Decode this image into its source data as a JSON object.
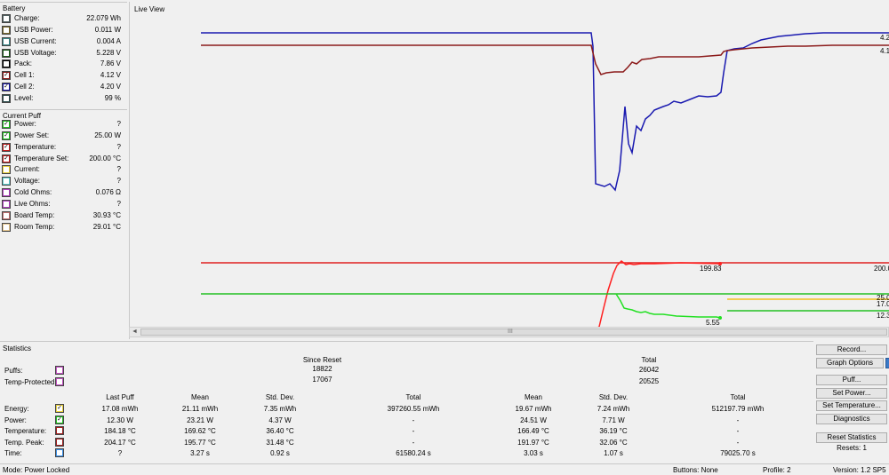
{
  "battery": {
    "title": "Battery",
    "rows": [
      {
        "label": "Charge:",
        "value": "22.079 Wh",
        "color": "#506060",
        "checked": false
      },
      {
        "label": "USB Power:",
        "value": "0.011 W",
        "color": "#7a6a2e",
        "checked": false
      },
      {
        "label": "USB Current:",
        "value": "0.004 A",
        "color": "#3a8a8a",
        "checked": false
      },
      {
        "label": "USB Voltage:",
        "value": "5.228 V",
        "color": "#1a5a1a",
        "checked": false
      },
      {
        "label": "Pack:",
        "value": "7.86 V",
        "color": "#000000",
        "checked": false
      },
      {
        "label": "Cell 1:",
        "value": "4.12 V",
        "color": "#8b1a1a",
        "checked": true
      },
      {
        "label": "Cell 2:",
        "value": "4.20 V",
        "color": "#1a1aa8",
        "checked": true
      },
      {
        "label": "Level:",
        "value": "99 %",
        "color": "#2e4e4e",
        "checked": false
      }
    ]
  },
  "current_puff": {
    "title": "Current Puff",
    "rows": [
      {
        "label": "Power:",
        "value": "?",
        "color": "#22c022",
        "checked": true
      },
      {
        "label": "Power Set:",
        "value": "25.00 W",
        "color": "#22c022",
        "checked": true
      },
      {
        "label": "Temperature:",
        "value": "?",
        "color": "#c02020",
        "checked": true
      },
      {
        "label": "Temperature Set:",
        "value": "200.00 °C",
        "color": "#c02020",
        "checked": true
      },
      {
        "label": "Current:",
        "value": "?",
        "color": "#e8d040",
        "checked": false
      },
      {
        "label": "Voltage:",
        "value": "?",
        "color": "#60d0d0",
        "checked": false
      },
      {
        "label": "Cold Ohms:",
        "value": "0.076 Ω",
        "color": "#b040c0",
        "checked": false
      },
      {
        "label": "Live Ohms:",
        "value": "?",
        "color": "#b040c0",
        "checked": false
      },
      {
        "label": "Board Temp:",
        "value": "30.93 °C",
        "color": "#c07070",
        "checked": false
      },
      {
        "label": "Room Temp:",
        "value": "29.01 °C",
        "color": "#e8c890",
        "checked": false
      }
    ]
  },
  "live_view": {
    "title": "Live View",
    "labels": {
      "cell2_end": "4.2",
      "cell1_end": "4.1",
      "temp_marker": "199.83",
      "temp_set_end": "200.0",
      "power_set_end": "25.0",
      "yellow_end": "17.0",
      "green_end": "12.3",
      "power_marker": "5.55"
    },
    "scroll_grip": "III",
    "scroll_arrow": "◄"
  },
  "statistics": {
    "title": "Statistics",
    "since_reset_header": "Since Reset",
    "total_header": "Total",
    "puffs_label": "Puffs:",
    "temp_protected_label": "Temp-Protected:",
    "puffs_since_reset": "18822",
    "puffs_total": "26042",
    "temp_protected_since_reset": "17067",
    "temp_protected_total": "20525",
    "columns": [
      "Last Puff",
      "Mean",
      "Std. Dev.",
      "Total",
      "Mean",
      "Std. Dev.",
      "Total"
    ],
    "rows": [
      {
        "label": "Energy:",
        "color": "#e8d040",
        "checked": true,
        "values": [
          "17.08 mWh",
          "21.11 mWh",
          "7.35 mWh",
          "397260.55 mWh",
          "19.67 mWh",
          "7.24 mWh",
          "512197.79 mWh"
        ]
      },
      {
        "label": "Power:",
        "color": "#22c022",
        "checked": true,
        "values": [
          "12.30 W",
          "23.21 W",
          "4.37 W",
          "-",
          "24.51 W",
          "7.71 W",
          "-"
        ]
      },
      {
        "label": "Temperature:",
        "color": "#a02020",
        "checked": false,
        "values": [
          "184.18 °C",
          "169.62 °C",
          "36.40 °C",
          "-",
          "166.49 °C",
          "36.19 °C",
          "-"
        ]
      },
      {
        "label": "Temp. Peak:",
        "color": "#a02020",
        "checked": false,
        "values": [
          "204.17 °C",
          "195.77 °C",
          "31.48 °C",
          "-",
          "191.97 °C",
          "32.06 °C",
          "-"
        ]
      },
      {
        "label": "Time:",
        "color": "#3a90e8",
        "checked": false,
        "values": [
          "?",
          "3.27 s",
          "0.92 s",
          "61580.24 s",
          "3.03 s",
          "1.07 s",
          "79025.70 s"
        ]
      }
    ]
  },
  "buttons": {
    "record": "Record...",
    "graph_options": "Graph Options",
    "puff": "Puff...",
    "set_power": "Set Power...",
    "set_temperature": "Set Temperature...",
    "diagnostics": "Diagnostics",
    "reset_statistics": "Reset Statistics",
    "resets": "Resets: 1"
  },
  "status": {
    "mode": "Mode: Power Locked",
    "buttons": "Buttons: None",
    "profile": "Profile: 2",
    "version": "Version: 1.2 SP5"
  }
}
